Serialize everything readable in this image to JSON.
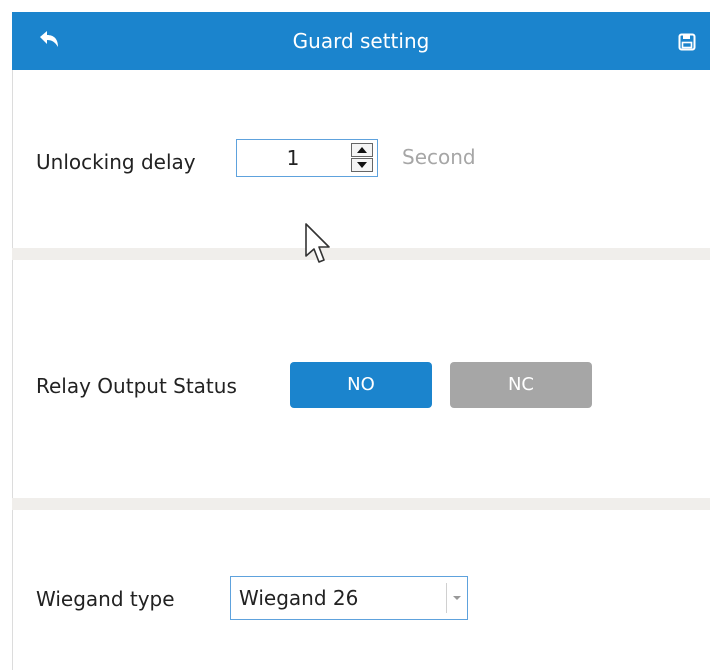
{
  "header": {
    "title": "Guard setting",
    "back_icon": "back-arrow-icon",
    "save_icon": "save-disk-icon"
  },
  "unlocking_delay": {
    "label": "Unlocking delay",
    "value": "1",
    "unit": "Second"
  },
  "relay_output": {
    "label": "Relay Output Status",
    "options": [
      "NO",
      "NC"
    ],
    "selected": "NO"
  },
  "wiegand": {
    "label": "Wiegand type",
    "selected": "Wiegand 26"
  },
  "colors": {
    "accent": "#1b84cd",
    "inactive": "#a6a6a6",
    "divider": "#f0eeeb"
  }
}
